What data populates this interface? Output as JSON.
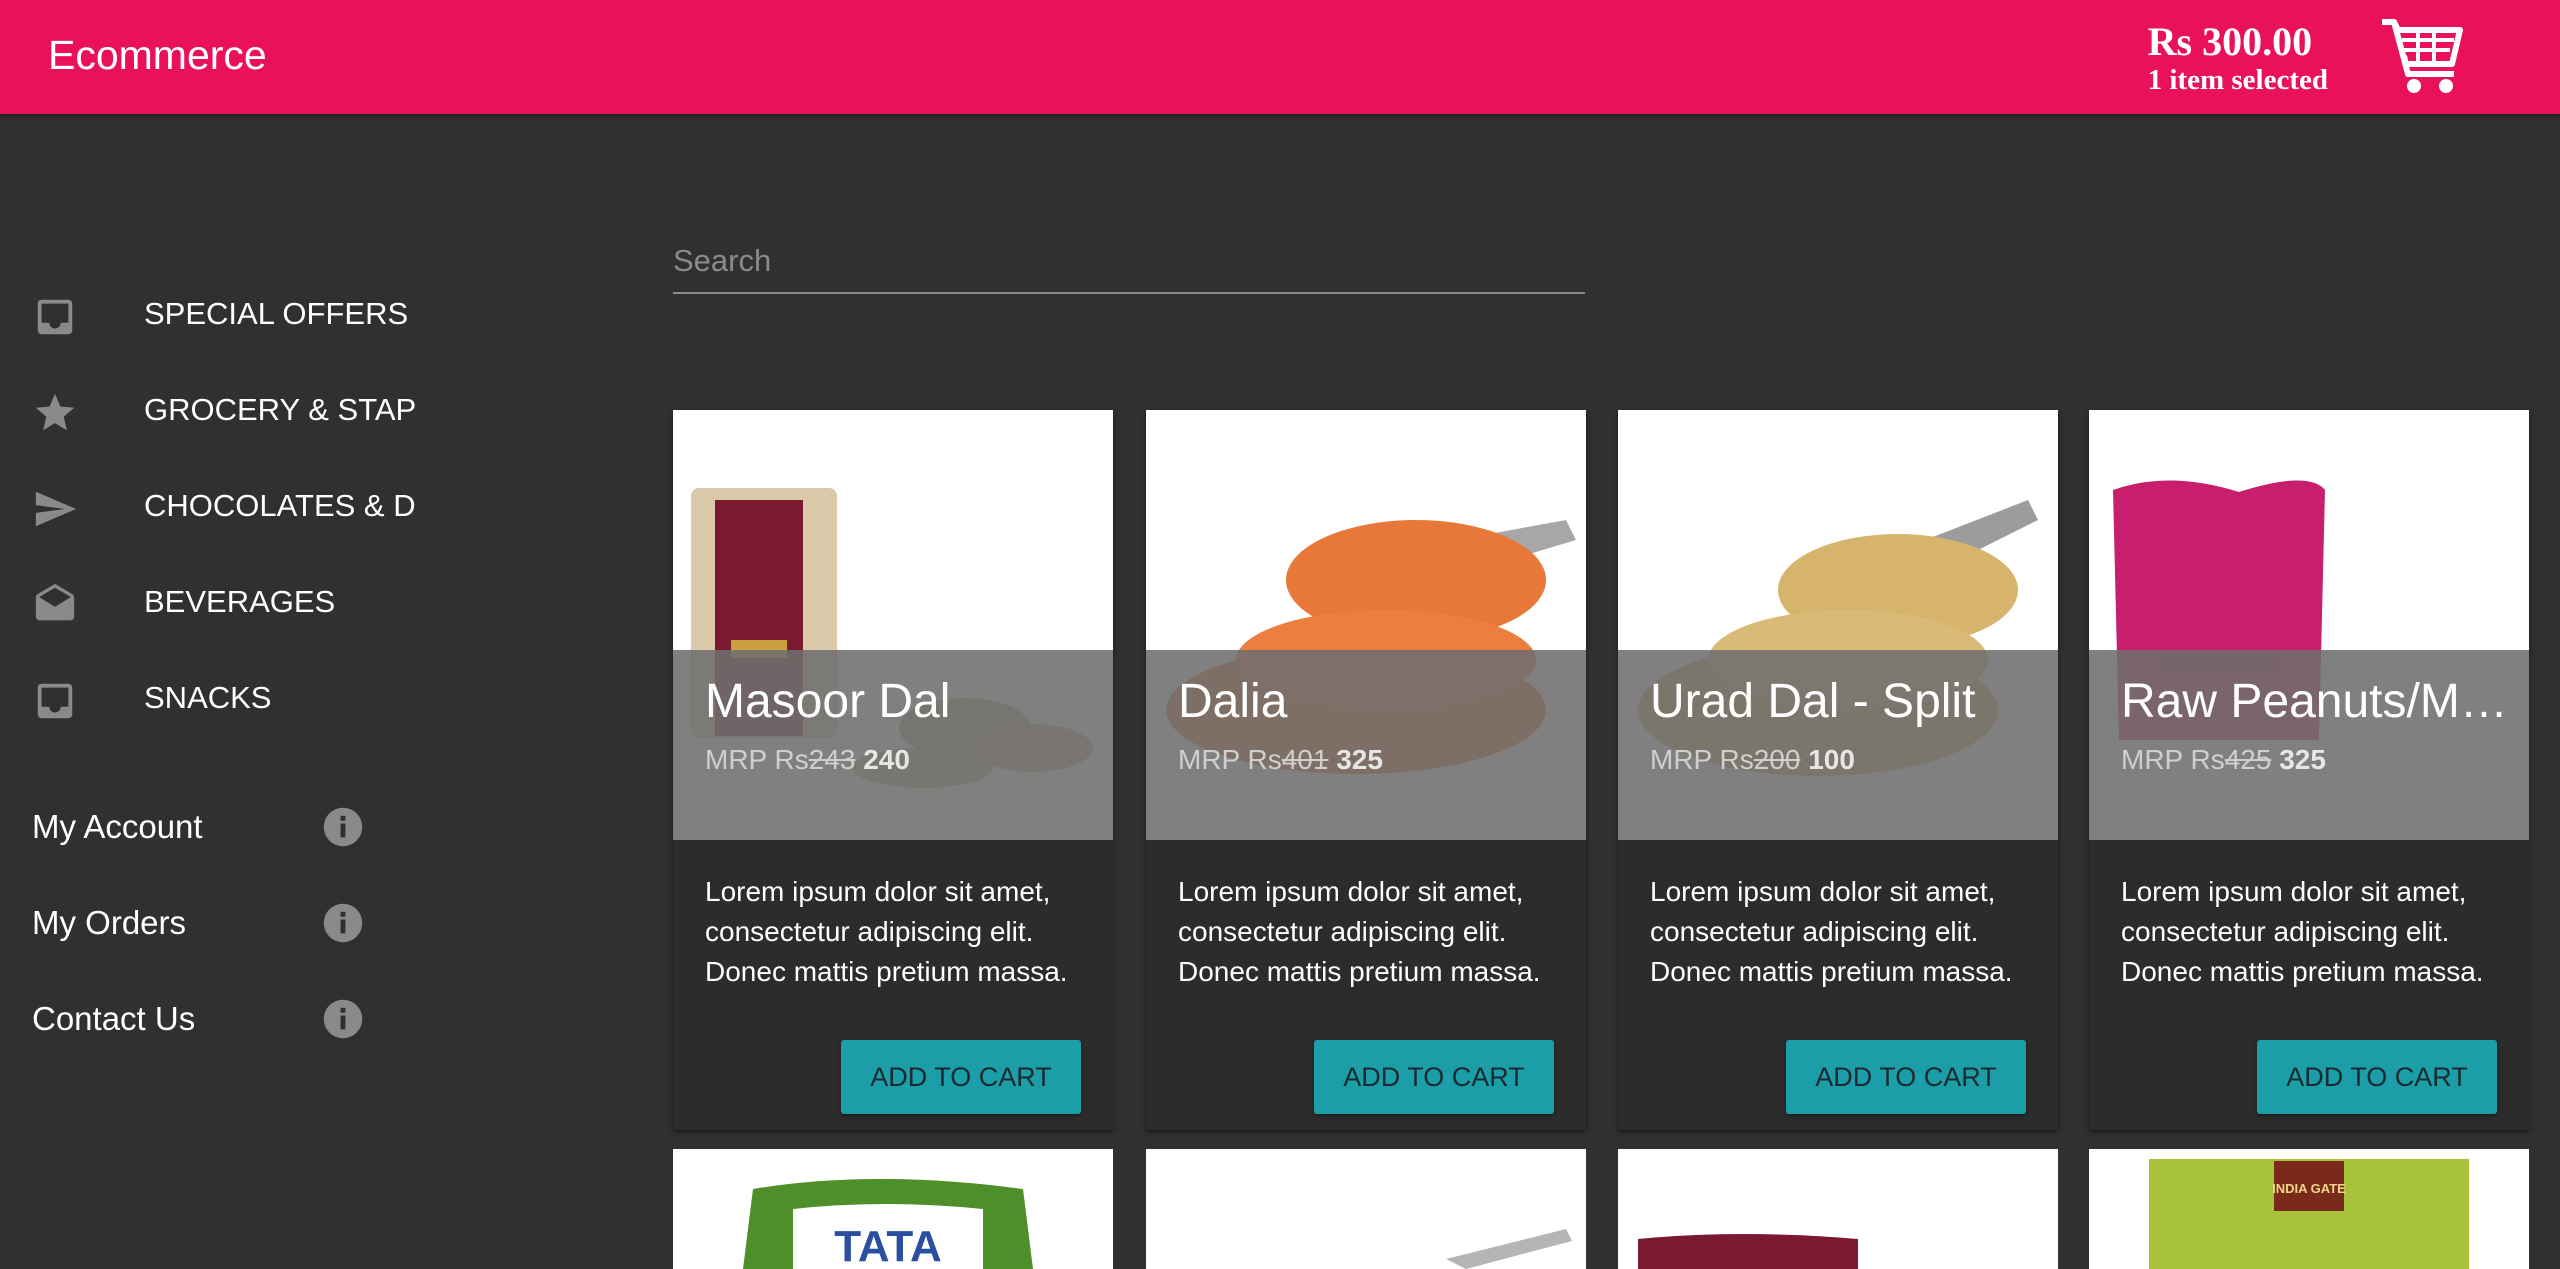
{
  "header": {
    "brand": "Ecommerce",
    "cart_total": "Rs 300.00",
    "cart_count": "1 item selected",
    "cart_icon": "shopping-cart-icon",
    "color": "#e91157"
  },
  "sidebar": {
    "categories": [
      {
        "label": "SPECIAL OFFERS",
        "icon": "inbox-icon"
      },
      {
        "label": "GROCERY & STAP",
        "icon": "star-icon"
      },
      {
        "label": "CHOCOLATES & D",
        "icon": "send-icon"
      },
      {
        "label": "BEVERAGES",
        "icon": "drafts-icon"
      },
      {
        "label": "SNACKS",
        "icon": "inbox-icon"
      }
    ],
    "account": [
      {
        "label": "My Account",
        "icon": "info-icon"
      },
      {
        "label": "My Orders",
        "icon": "info-icon"
      },
      {
        "label": "Contact Us",
        "icon": "info-icon"
      }
    ]
  },
  "search": {
    "placeholder": "Search",
    "value": ""
  },
  "products": [
    {
      "name": "Masoor Dal",
      "mrp_prefix": "MRP Rs",
      "mrp": "243",
      "price": "240",
      "description": "Lorem ipsum dolor sit amet, consectetur adipiscing elit. Donec mattis pretium massa.",
      "button": "ADD TO CART"
    },
    {
      "name": "Dalia",
      "mrp_prefix": "MRP Rs",
      "mrp": "401",
      "price": "325",
      "description": "Lorem ipsum dolor sit amet, consectetur adipiscing elit. Donec mattis pretium massa.",
      "button": "ADD TO CART"
    },
    {
      "name": "Urad Dal - Split",
      "mrp_prefix": "MRP Rs",
      "mrp": "200",
      "price": "100",
      "description": "Lorem ipsum dolor sit amet, consectetur adipiscing elit. Donec mattis pretium massa.",
      "button": "ADD TO CART"
    },
    {
      "name": "Raw Peanuts/Mu…",
      "mrp_prefix": "MRP Rs",
      "mrp": "425",
      "price": "325",
      "description": "Lorem ipsum dolor sit amet, consectetur adipiscing elit. Donec mattis pretium massa.",
      "button": "ADD TO CART"
    }
  ],
  "next_row_labels": [
    "TATA",
    "INDIA GATE"
  ],
  "colors": {
    "background": "#303030",
    "accent_button": "#1b9ea8"
  }
}
